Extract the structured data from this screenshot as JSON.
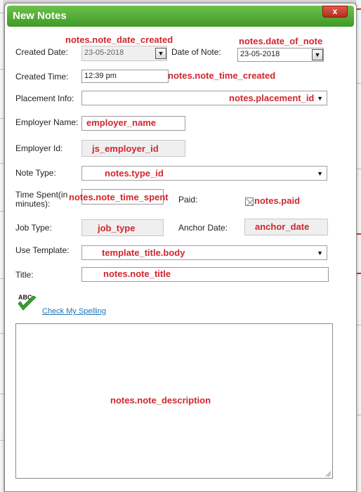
{
  "dialog": {
    "title": "New Notes",
    "close_label": "x"
  },
  "labels": {
    "created_date": "Created Date:",
    "date_of_note": "Date of Note:",
    "created_time": "Created Time:",
    "placement_info": "Placement Info:",
    "employer_name": "Employer Name:",
    "employer_id": "Employer Id:",
    "note_type": "Note Type:",
    "time_spent": "Time Spent(in minutes):",
    "paid": "Paid:",
    "job_type": "Job Type:",
    "anchor_date": "Anchor Date:",
    "use_template": "Use Template:",
    "title": "Title:"
  },
  "fields": {
    "created_date_value": "23-05-2018",
    "date_of_note_value": "23-05-2018",
    "created_time_value": "12:39 pm"
  },
  "markers": {
    "note_date_created": "notes.note_date_created",
    "date_of_note": "notes.date_of_note",
    "note_time_created": "notes.note_time_created",
    "placement_id": "notes.placement_id",
    "employer_name": "employer_name",
    "employer_id": "js_employer_id",
    "type_id": "notes.type_id",
    "note_time_spent": "notes.note_time_spent",
    "paid": "notes.paid",
    "job_type": "job_type",
    "anchor_date": "anchor_date",
    "template_body": "template_title.body",
    "note_title": "notes.note_title",
    "note_description": "notes.note_description"
  },
  "spelling": {
    "icon_text": "ABC",
    "link_label": "Check My Spelling"
  },
  "icons": {
    "dropdown": "chevron-down-icon",
    "calendar_dropdown": "dropdown-button-icon",
    "spell": "abc-checkmark-icon"
  },
  "colors": {
    "titlebar": "#4fae33",
    "marker": "#d0262d",
    "link": "#1a73b8",
    "close": "#c4392a"
  }
}
